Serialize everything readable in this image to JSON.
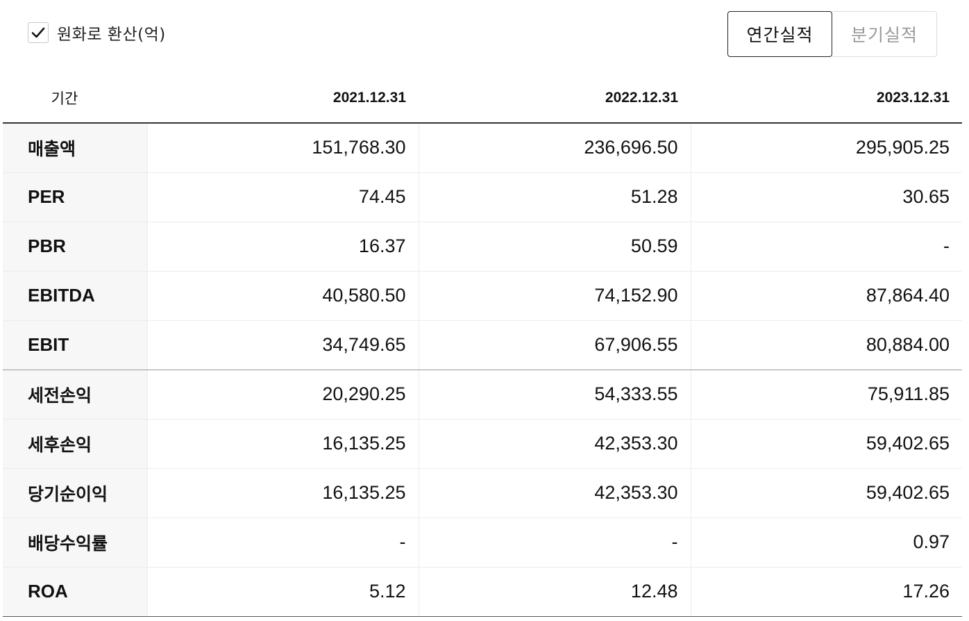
{
  "options": {
    "krw_label": "원화로 환산(억)",
    "krw_checked": true
  },
  "period_toggle": {
    "annual_label": "연간실적",
    "quarter_label": "분기실적",
    "selected": "annual"
  },
  "table": {
    "period_header": "기간",
    "columns": [
      "2021.12.31",
      "2022.12.31",
      "2023.12.31"
    ],
    "rows": [
      {
        "label": "매출액",
        "values": [
          "151,768.30",
          "236,696.50",
          "295,905.25"
        ]
      },
      {
        "label": "PER",
        "values": [
          "74.45",
          "51.28",
          "30.65"
        ]
      },
      {
        "label": "PBR",
        "values": [
          "16.37",
          "50.59",
          "-"
        ]
      },
      {
        "label": "EBITDA",
        "values": [
          "40,580.50",
          "74,152.90",
          "87,864.40"
        ]
      },
      {
        "label": "EBIT",
        "values": [
          "34,749.65",
          "67,906.55",
          "80,884.00"
        ]
      },
      {
        "label": "세전손익",
        "values": [
          "20,290.25",
          "54,333.55",
          "75,911.85"
        ]
      },
      {
        "label": "세후손익",
        "values": [
          "16,135.25",
          "42,353.30",
          "59,402.65"
        ]
      },
      {
        "label": "당기순이익",
        "values": [
          "16,135.25",
          "42,353.30",
          "59,402.65"
        ]
      },
      {
        "label": "배당수익률",
        "values": [
          "-",
          "-",
          "0.97"
        ]
      },
      {
        "label": "ROA",
        "values": [
          "5.12",
          "12.48",
          "17.26"
        ]
      }
    ]
  },
  "icons": {
    "checkbox_check": "check-icon"
  }
}
